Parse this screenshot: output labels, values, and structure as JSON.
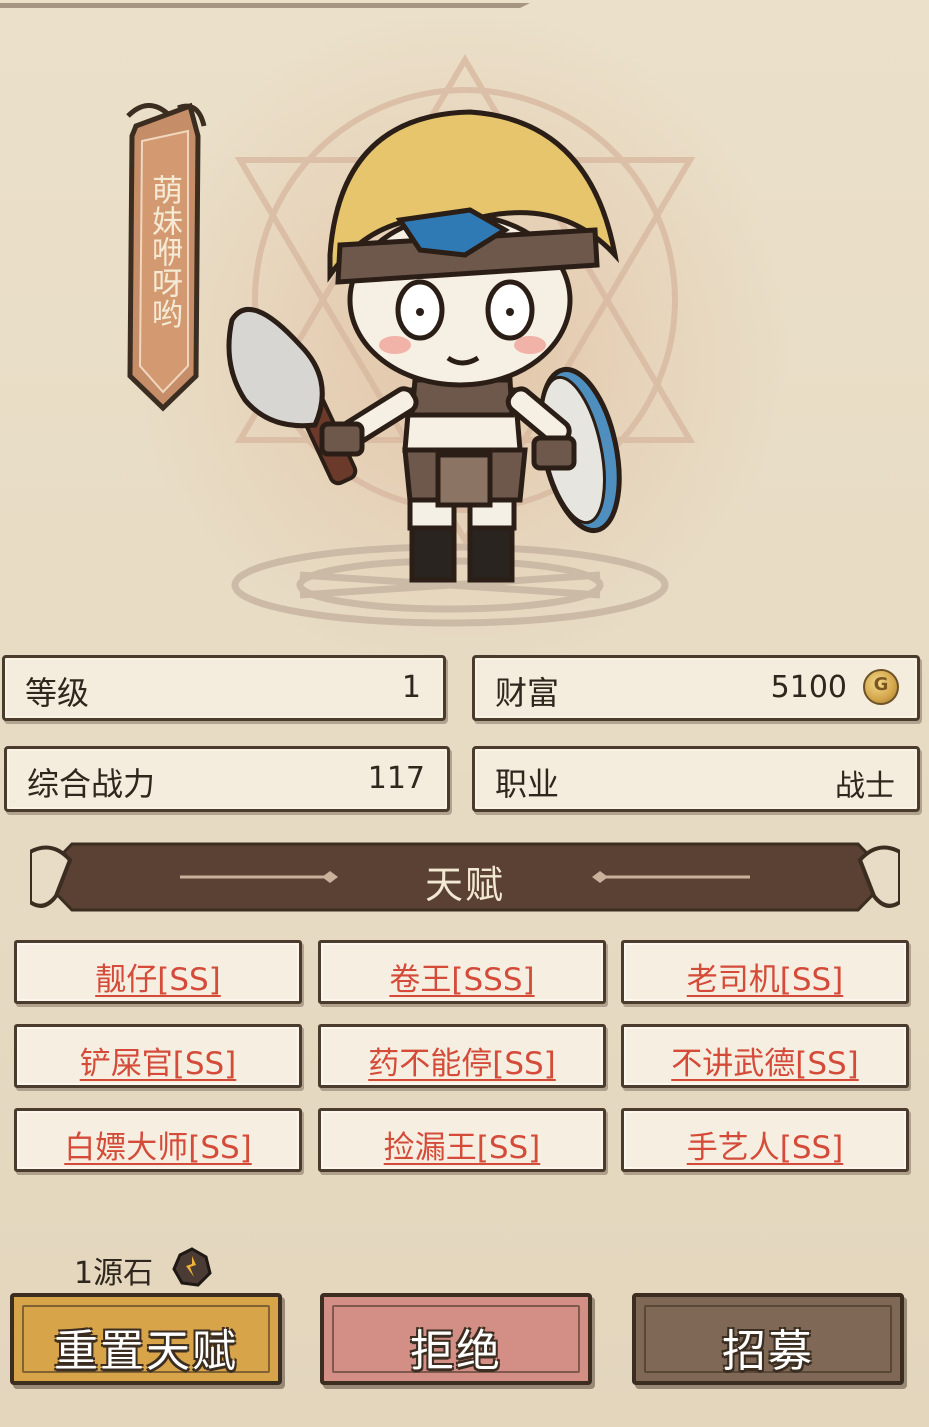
{
  "hero": {
    "name": "萌妹咿呀哟"
  },
  "stats": {
    "level_label": "等级",
    "level_value": "1",
    "wealth_label": "财富",
    "wealth_value": "5100",
    "power_label": "综合战力",
    "power_value": "117",
    "class_label": "职业",
    "class_value": "战士"
  },
  "talents": {
    "title": "天赋",
    "items": [
      {
        "label": "靓仔[SS]"
      },
      {
        "label": "卷王[SSS]"
      },
      {
        "label": "老司机[SS]"
      },
      {
        "label": "铲屎官[SS]"
      },
      {
        "label": "药不能停[SS]"
      },
      {
        "label": "不讲武德[SS]"
      },
      {
        "label": "白嫖大师[SS]"
      },
      {
        "label": "捡漏王[SS]"
      },
      {
        "label": "手艺人[SS]"
      }
    ]
  },
  "reset_cost": {
    "text": "1源石",
    "icon": "source-stone-icon"
  },
  "actions": {
    "reset_label": "重置天赋",
    "reject_label": "拒绝",
    "recruit_label": "招募"
  },
  "icons": {
    "coin": "gold-coin-icon",
    "stone": "source-stone-icon"
  },
  "colors": {
    "talent_text": "#d44b3a",
    "band": "#5a4134",
    "reset_button": "#d7a44a",
    "reject_button": "#d38e86",
    "recruit_button": "#7f6855"
  }
}
